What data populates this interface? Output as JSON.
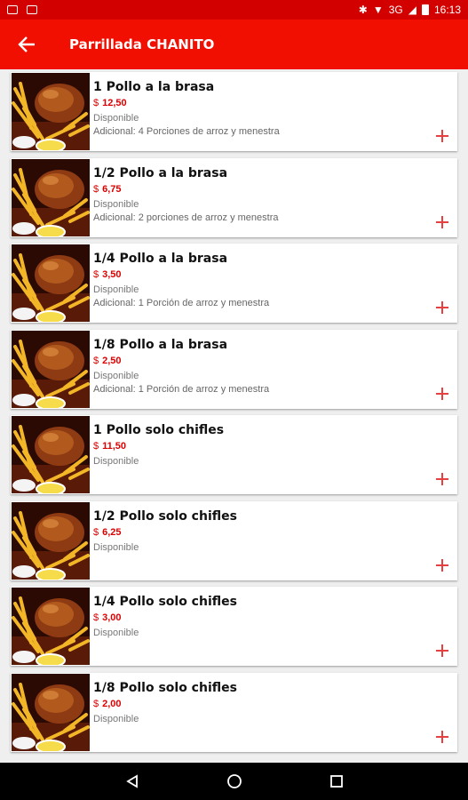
{
  "status_bar": {
    "time": "16:13",
    "network": "3G"
  },
  "header": {
    "title": "Parrillada CHANITO"
  },
  "colors": {
    "brand": "#f00f00",
    "status_bar": "#d30000",
    "price": "#dd0000",
    "add": "#e84040"
  },
  "currency_symbol": "$",
  "items": [
    {
      "name": "1 Pollo a la brasa",
      "price": "12,50",
      "status": "Disponible",
      "extra": "Adicional: 4 Porciones de arroz y menestra"
    },
    {
      "name": "1/2 Pollo a la brasa",
      "price": "6,75",
      "status": "Disponible",
      "extra": "Adicional: 2 porciones de arroz y menestra"
    },
    {
      "name": "1/4 Pollo a la brasa",
      "price": "3,50",
      "status": "Disponible",
      "extra": "Adicional: 1 Porción de arroz y menestra"
    },
    {
      "name": "1/8 Pollo a la brasa",
      "price": "2,50",
      "status": "Disponible",
      "extra": "Adicional: 1 Porción de arroz y menestra"
    },
    {
      "name": "1 Pollo solo chifles",
      "price": "11,50",
      "status": "Disponible",
      "extra": ""
    },
    {
      "name": "1/2 Pollo solo chifles",
      "price": "6,25",
      "status": "Disponible",
      "extra": ""
    },
    {
      "name": "1/4 Pollo solo chifles",
      "price": "3,00",
      "status": "Disponible",
      "extra": ""
    },
    {
      "name": "1/8 Pollo solo chifles",
      "price": "2,00",
      "status": "Disponible",
      "extra": ""
    }
  ],
  "icons": {
    "back": "arrow-left-icon",
    "add": "plus-icon",
    "nav_back": "triangle-back-icon",
    "nav_home": "circle-home-icon",
    "nav_recent": "square-recent-icon"
  }
}
